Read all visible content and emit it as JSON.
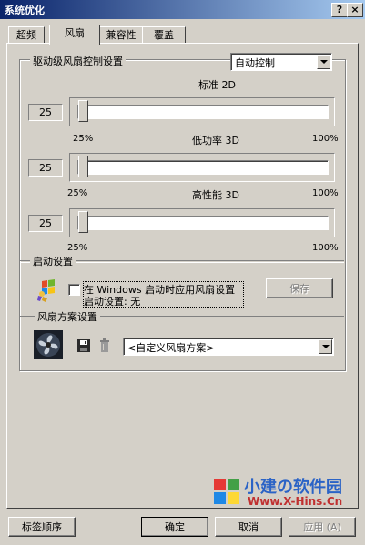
{
  "window": {
    "title": "系统优化",
    "help_label": "?",
    "close_label": "×"
  },
  "tabs": [
    {
      "label": "超频",
      "active": false
    },
    {
      "label": "风扇",
      "active": true
    },
    {
      "label": "兼容性",
      "active": false
    },
    {
      "label": "覆盖",
      "active": false
    }
  ],
  "driver_group": {
    "label": "驱动级风扇控制设置",
    "mode_select": "自动控制",
    "sliders": [
      {
        "title": "标准 2D",
        "value": "25",
        "min_label": "",
        "max_label": "",
        "level": 0
      },
      {
        "title": "低功率 3D",
        "value": "25",
        "min_label": "25%",
        "max_label": "100%",
        "level": 0
      },
      {
        "title": "高性能 3D",
        "value": "25",
        "min_label": "25%",
        "max_label": "100%",
        "level": 0
      }
    ],
    "bottom_min_label": "25%",
    "bottom_max_label": "100%"
  },
  "startup_group": {
    "label": "启动设置",
    "checkbox_label": "在 Windows 启动时应用风扇设置",
    "checkbox_checked": false,
    "status": "启动设置: 无",
    "save_label": "保存"
  },
  "scheme_group": {
    "label": "风扇方案设置",
    "scheme_select": "<自定义风扇方案>"
  },
  "watermark": {
    "brand": "小建の软件园",
    "url": "Www.X-Hins.Cn"
  },
  "footer": {
    "tab_order_label": "标签顺序",
    "ok_label": "确定",
    "cancel_label": "取消",
    "apply_label": "应用 (A)"
  }
}
